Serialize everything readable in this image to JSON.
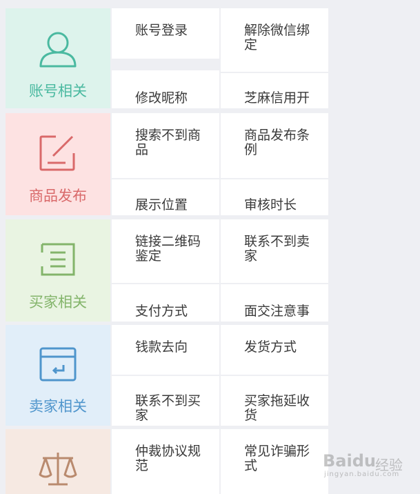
{
  "categories": [
    {
      "label": "账号相关",
      "icon": "user-icon",
      "bg": "#ddf3ec",
      "color": "#4ab9a0"
    },
    {
      "label": "商品发布",
      "icon": "edit-icon",
      "bg": "#fde2e2",
      "color": "#d9696a"
    },
    {
      "label": "买家相关",
      "icon": "list-icon",
      "bg": "#e9f4e2",
      "color": "#83b46a"
    },
    {
      "label": "卖家相关",
      "icon": "wallet-icon",
      "bg": "#e1eef9",
      "color": "#4f95cc"
    },
    {
      "label": "",
      "icon": "scale-icon",
      "bg": "#f6e9e2",
      "color": "#b98a6e"
    }
  ],
  "topics": [
    [
      "账号登录",
      "解除微信绑定",
      "修改昵称",
      "芝麻信用开"
    ],
    [
      "搜索不到商品",
      "商品发布条例",
      "展示位置",
      "审核时长"
    ],
    [
      "链接二维码鉴定",
      "联系不到卖家",
      "支付方式",
      "面交注意事"
    ],
    [
      "钱款去向",
      "发货方式",
      "联系不到买家",
      "买家拖延收货"
    ],
    [
      "仲裁协议规范",
      "常见诈骗形式"
    ]
  ],
  "watermark": {
    "brand": "Baidu",
    "cn": "经验",
    "url": "jingyan.baidu.com"
  }
}
